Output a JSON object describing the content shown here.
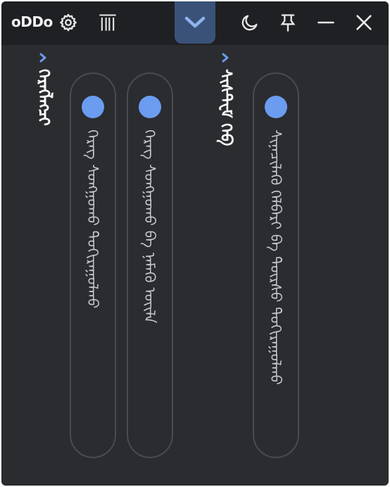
{
  "app": {
    "logo": "oDDo"
  },
  "toolbar": {
    "icons": [
      "gear-icon",
      "columns-icon",
      "chevron-down-icon",
      "moon-icon",
      "pin-icon",
      "minimize-icon",
      "close-icon"
    ]
  },
  "colors": {
    "window_bg": "#2b2c2f",
    "titlebar_bg": "#1f2023",
    "accent": "#6b9cf0",
    "collapse_bg": "#3a5278",
    "pill_border": "#4a4b4f",
    "text_primary": "#ffffff",
    "text_secondary": "#c8c8cc"
  },
  "groups": [
    {
      "title": "ᠬᠡᠷᠡᠭᠯᠡᠭᠴᠢ",
      "items": [
        {
          "label": "ᠬᠡᠷᠡᠭ ᠰᠣᠩᠭᠣᠬᠤ ᠲᠣᠬᠢᠷᠠᠭᠤᠯᠬᠤ"
        },
        {
          "label": "ᠬᠡᠷᠡᠭ ᠰᠣᠩᠭᠣᠬᠤ ᠪᠠ ᠨᠡᠮᠡᠬᠦ ᠦᠢᠯᠡ"
        }
      ]
    },
    {
      "title": "ᠰᠢᠰᠲ᠋ᠧᠮ ᠬᠡᠪ",
      "items": [
        {
          "label": "ᠰᠢᠨᠡᠴᠢᠯᠡᠬᠦ ᠬᠡᠯᠪᠡᠷᠢ ᠪᠠ ᠳᠦᠷᠰᠦ ᠲᠣᠬᠢᠷᠠᠭᠤᠯᠬᠤ"
        }
      ]
    }
  ]
}
